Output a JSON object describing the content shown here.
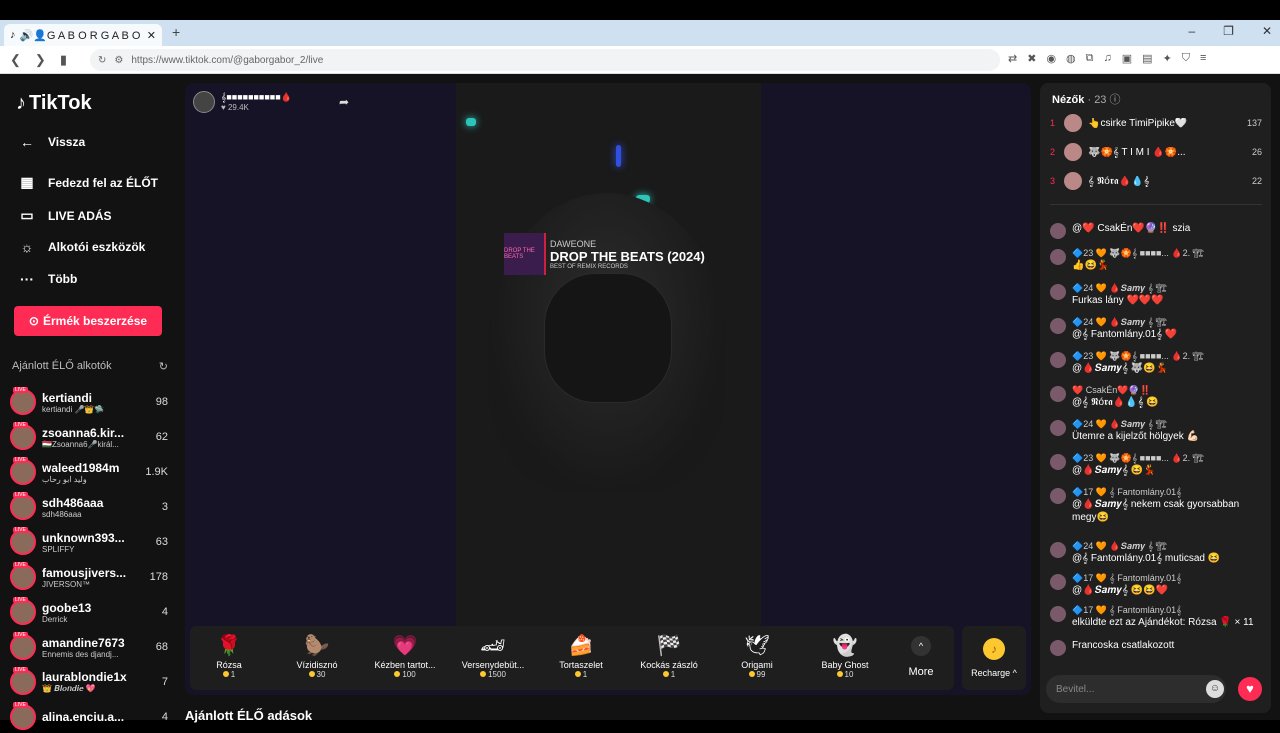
{
  "browser": {
    "tab_title": "🔊👤G A B O R G A B O R e...",
    "new_tab": "+",
    "url": "https://www.tiktok.com/@gaborgabor_2/live",
    "controls": [
      "–",
      "❐",
      "✕"
    ]
  },
  "sidebar": {
    "logo": "TikTok",
    "back": "Vissza",
    "items": [
      {
        "label": "Fedezd fel az ÉLŐT",
        "icon": "calendar-icon"
      },
      {
        "label": "LIVE ADÁS",
        "icon": "camera-icon"
      },
      {
        "label": "Alkotói eszközök",
        "icon": "lightbulb-icon"
      },
      {
        "label": "Több",
        "icon": "more-icon"
      }
    ],
    "coin_button": "Érmék beszerzése",
    "recommended_heading": "Ajánlott ÉLŐ alkotók",
    "creators": [
      {
        "name": "kertiandi",
        "sub": "kertiandi 🎤👑🛸",
        "count": "98"
      },
      {
        "name": "zsoanna6.kir...",
        "sub": "🇭🇺Zsoanna6🎤királ...",
        "count": "62"
      },
      {
        "name": "waleed1984m",
        "sub": "وليد ابو رحاب",
        "count": "1.9K"
      },
      {
        "name": "sdh486aaa",
        "sub": "sdh486aaa",
        "count": "3"
      },
      {
        "name": "unknown393...",
        "sub": "SPLIFFY",
        "count": "63"
      },
      {
        "name": "famousjivers...",
        "sub": "JIVERSON™",
        "count": "178"
      },
      {
        "name": "goobe13",
        "sub": "Derrick",
        "count": "4"
      },
      {
        "name": "amandine7673",
        "sub": "Ennemis des djandj...",
        "count": "68"
      },
      {
        "name": "laurablondie1x",
        "sub": "👑 𝑩𝒍𝒐𝒏𝒅𝒊𝒆 💖",
        "count": "7"
      },
      {
        "name": "alina.enciu.a...",
        "sub": "",
        "count": "4"
      }
    ]
  },
  "stream": {
    "host_name": "𝄞■■■■■■■■■■🩸",
    "viewers": "29.4K",
    "banner_artist": "DAWEONE",
    "banner_title": "DROP THE BEATS (2024)",
    "banner_label": "BEST OF REMIX RECORDS",
    "banner_art": "DROP THE BEATS"
  },
  "gifts": [
    {
      "name": "Rózsa",
      "price": "1",
      "icon": "rose-icon",
      "glyph": "🌹"
    },
    {
      "name": "Vízidisznó",
      "price": "30",
      "icon": "capybara-icon",
      "glyph": "🦫"
    },
    {
      "name": "Kézben tartot...",
      "price": "100",
      "icon": "heart-hands-icon",
      "glyph": "💗"
    },
    {
      "name": "Versenydebüt...",
      "price": "1500",
      "icon": "race-car-icon",
      "glyph": "🏎"
    },
    {
      "name": "Tortaszelet",
      "price": "1",
      "icon": "cake-icon",
      "glyph": "🍰"
    },
    {
      "name": "Kockás zászló",
      "price": "1",
      "icon": "checkered-flag-icon",
      "glyph": "🏁"
    },
    {
      "name": "Origami",
      "price": "99",
      "icon": "origami-icon",
      "glyph": "🕊"
    },
    {
      "name": "Baby Ghost",
      "price": "10",
      "icon": "ghost-icon",
      "glyph": "👻"
    }
  ],
  "more_label": "More",
  "recharge_label": "Recharge ^",
  "bottom_title": "Ajánlott ÉLŐ adások",
  "chat": {
    "viewers_label": "Nézők",
    "viewers_count": "· 23",
    "top_viewers": [
      {
        "rank": "1",
        "name": "👆csirke TimiPipike🤍",
        "score": "137"
      },
      {
        "rank": "2",
        "name": "🐺🏵️𝄞 T I M I 🩸🏵️...",
        "score": "26"
      },
      {
        "rank": "3",
        "name": "𝄞 𝕹ó𝖗𝖆🩸💧𝄞",
        "score": "22"
      }
    ],
    "messages": [
      {
        "top": "",
        "text": "@❤️ CsakÉn❤️🔮‼️ szia"
      },
      {
        "top": "🔷23 🧡 🐺🏵️𝄞 ■■■■... 🩸2. 🏗",
        "text": "👍😆💃"
      },
      {
        "top": "🔷24 🧡 🩸𝑺𝒂𝒎𝒚 𝄞 🏗",
        "text": "Furkas lány ❤️❤️❤️"
      },
      {
        "top": "🔷24 🧡 🩸𝑺𝒂𝒎𝒚 𝄞 🏗",
        "text": "@𝄞 Fantomlány.01𝄞 ❤️"
      },
      {
        "top": "🔷23 🧡 🐺🏵️𝄞 ■■■■... 🩸2. 🏗",
        "text": "@🩸𝑺𝒂𝒎𝒚𝄞 🐺😆💃"
      },
      {
        "top": "❤️ CsakÉn❤️🔮‼️",
        "text": "@𝄞 𝕹ó𝖗𝖆🩸💧𝄞 😆"
      },
      {
        "top": "🔷24 🧡 🩸𝑺𝒂𝒎𝒚 𝄞 🏗",
        "text": "Ütemre a kijelzőt hölgyek 💪🏻"
      },
      {
        "top": "🔷23 🧡 🐺🏵️𝄞 ■■■■... 🩸2. 🏗",
        "text": "@🩸𝑺𝒂𝒎𝒚𝄞 😆💃"
      },
      {
        "top": "🔷17 🧡 𝄞 Fantomlány.01𝄞",
        "text": "@🩸𝑺𝒂𝒎𝒚𝄞 nekem csak gyorsabban megy😆"
      },
      {
        "top": "🔷24 🧡 🩸𝑺𝒂𝒎𝒚 𝄞 🏗",
        "text": "@𝄞 Fantomlány.01𝄞 muticsad 😆"
      },
      {
        "top": "🔷17 🧡 𝄞 Fantomlány.01𝄞",
        "text": "@🩸𝑺𝒂𝒎𝒚𝄞 😆😆❤️"
      },
      {
        "top": "🔷17 🧡 𝄞 Fantomlány.01𝄞",
        "text": "elküldte ezt az Ajándékot: Rózsa 🌹 × 11"
      },
      {
        "top": "",
        "text": "Francoska  csatlakozott"
      }
    ],
    "input_placeholder": "Bevitel..."
  },
  "colors": {
    "accent": "#fe2c55",
    "coin": "#fdc72f",
    "badge": "#5b6cf0"
  }
}
